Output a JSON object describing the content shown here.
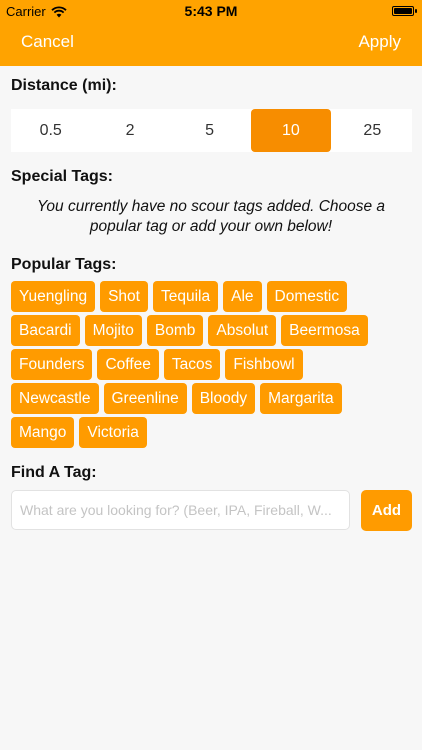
{
  "status_bar": {
    "carrier": "Carrier",
    "time": "5:43 PM",
    "battery_level": 1.0
  },
  "nav": {
    "cancel_label": "Cancel",
    "apply_label": "Apply"
  },
  "distance": {
    "title": "Distance (mi):",
    "options": [
      "0.5",
      "2",
      "5",
      "10",
      "25"
    ],
    "selected": "10"
  },
  "special_tags": {
    "title": "Special Tags:",
    "empty_message": "You currently have no scour tags added. Choose a popular tag or add your own below!"
  },
  "popular_tags": {
    "title": "Popular Tags:",
    "rows": [
      [
        "Yuengling",
        "Shot",
        "Tequila",
        "Ale",
        "Domestic"
      ],
      [
        "Bacardi",
        "Mojito",
        "Bomb",
        "Absolut",
        "Beermosa"
      ],
      [
        "Founders",
        "Coffee",
        "Tacos",
        "Fishbowl"
      ],
      [
        "Newcastle",
        "Greenline",
        "Bloody",
        "Margarita"
      ],
      [
        "Mango",
        "Victoria"
      ]
    ]
  },
  "find_tag": {
    "title": "Find A Tag:",
    "placeholder": "What are you looking for? (Beer, IPA, Fireball, W...",
    "value": "",
    "add_label": "Add"
  },
  "colors": {
    "header": "#ffa300",
    "selected_segment": "#f78d00",
    "tag": "#ff9b00",
    "background": "#f7f7f7"
  }
}
